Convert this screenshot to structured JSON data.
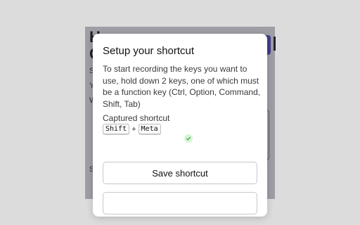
{
  "background": {
    "heading_line1": "H",
    "heading_line2": "C",
    "line_s": "S",
    "line_y": "Y",
    "line_w": "W",
    "line_bottom": "S"
  },
  "dialog": {
    "title": "Setup your shortcut",
    "description": "To start recording the keys you want to use, hold down 2 keys, one of which must be a function key (Ctrl, Option, Command, Shift, Tab)",
    "captured_label": "Captured shortcut",
    "keys": [
      "Shift",
      "Meta"
    ],
    "key_separator": "+",
    "save_button": "Save shortcut",
    "second_button": ""
  },
  "colors": {
    "accent": "#5b4fcf",
    "success_dot": "#d8f3d8",
    "success_check": "#3aa63a"
  }
}
